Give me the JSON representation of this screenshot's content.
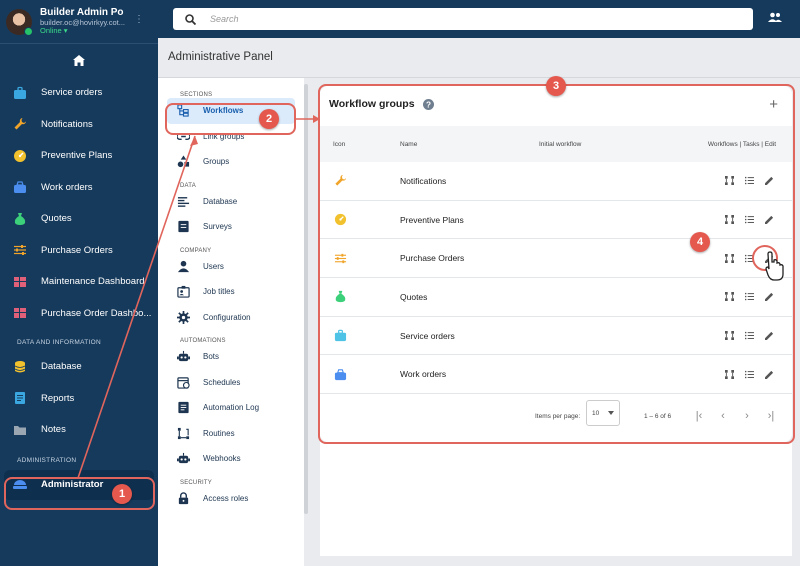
{
  "profile": {
    "name": "Builder Admin Po",
    "email": "builder.oc@hovirkyy.cot...",
    "status": "Online"
  },
  "search": {
    "placeholder": "Search"
  },
  "sidebar": {
    "items": [
      {
        "label": "Service orders",
        "icon": "briefcase-icon",
        "color": "#3aa7e0"
      },
      {
        "label": "Notifications",
        "icon": "wrench-icon",
        "color": "#f0a42a"
      },
      {
        "label": "Preventive Plans",
        "icon": "gauge-icon",
        "color": "#f2c12e"
      },
      {
        "label": "Work orders",
        "icon": "toolbox-icon",
        "color": "#4b8ef0"
      },
      {
        "label": "Quotes",
        "icon": "money-bag-icon",
        "color": "#3cd07a"
      },
      {
        "label": "Purchase Orders",
        "icon": "sliders-icon",
        "color": "#f0a42a"
      },
      {
        "label": "Maintenance Dashboard",
        "icon": "dashboard-icon",
        "color": "#e0607a"
      },
      {
        "label": "Purchase Order Dashbo...",
        "icon": "dashboard-icon",
        "color": "#e0607a"
      }
    ],
    "section_data": "DATA AND INFORMATION",
    "data_items": [
      {
        "label": "Database",
        "icon": "database-icon",
        "color": "#f2c12e"
      },
      {
        "label": "Reports",
        "icon": "report-icon",
        "color": "#3aa7e0"
      },
      {
        "label": "Notes",
        "icon": "folder-icon",
        "color": "#9aa6b2"
      }
    ],
    "section_admin": "ADMINISTRATION",
    "admin_item": {
      "label": "Administrator",
      "icon": "admin-icon",
      "color": "#4b8ef0"
    }
  },
  "page": {
    "title": "Administrative Panel"
  },
  "sections": {
    "groups": [
      {
        "heading": "SECTIONS",
        "items": [
          "Workflows",
          "Link groups",
          "Groups"
        ]
      },
      {
        "heading": "DATA",
        "items": [
          "Database",
          "Surveys"
        ]
      },
      {
        "heading": "COMPANY",
        "items": [
          "Users",
          "Job titles",
          "Configuration"
        ]
      },
      {
        "heading": "AUTOMATIONS",
        "items": [
          "Bots",
          "Schedules",
          "Automation Log",
          "Routines",
          "Webhooks"
        ]
      },
      {
        "heading": "SECURITY",
        "items": [
          "Access roles"
        ]
      }
    ]
  },
  "card": {
    "title": "Workflow groups",
    "columns": {
      "icon": "Icon",
      "name": "Name",
      "initial": "Initial workflow",
      "actions": "Workflows | Tasks | Edit"
    },
    "rows": [
      {
        "name": "Notifications",
        "icon": "wrench-icon",
        "color": "#f0a42a"
      },
      {
        "name": "Preventive Plans",
        "icon": "gauge-icon",
        "color": "#f2c12e"
      },
      {
        "name": "Purchase Orders",
        "icon": "sliders-icon",
        "color": "#f0a42a"
      },
      {
        "name": "Quotes",
        "icon": "money-bag-icon",
        "color": "#3cd07a"
      },
      {
        "name": "Service orders",
        "icon": "briefcase-icon",
        "color": "#4fc3e6"
      },
      {
        "name": "Work orders",
        "icon": "toolbox-icon",
        "color": "#4b8ef0"
      }
    ],
    "pager": {
      "items_per_page_label": "Items per page:",
      "items_per_page": "10",
      "range": "1 – 6 of 6"
    }
  },
  "callouts": [
    "1",
    "2",
    "3",
    "4"
  ]
}
